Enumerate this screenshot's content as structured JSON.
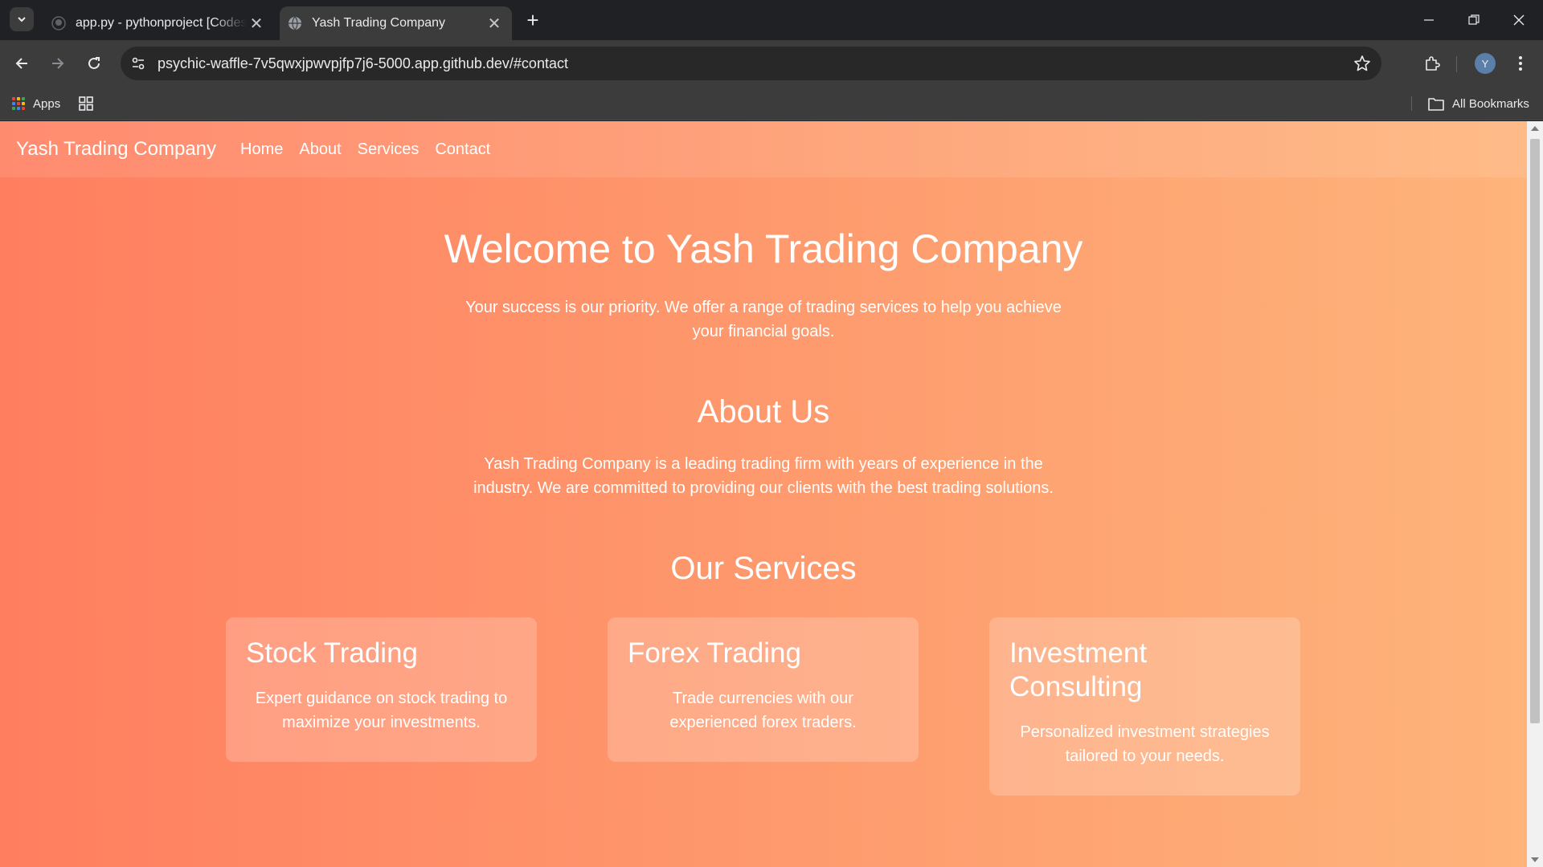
{
  "browser": {
    "tabs": [
      {
        "title": "app.py - pythonproject [Codespaces: psychic waffle]",
        "favicon": "github-icon",
        "active": false
      },
      {
        "title": "Yash Trading Company",
        "favicon": "globe-icon",
        "active": true
      }
    ],
    "url": "psychic-waffle-7v5qwxjpwvpjfp7j6-5000.app.github.dev/#contact",
    "avatar_letter": "Y",
    "bookmarks": {
      "apps_label": "Apps",
      "all_bookmarks_label": "All Bookmarks"
    }
  },
  "site": {
    "brand": "Yash Trading Company",
    "nav": [
      "Home",
      "About",
      "Services",
      "Contact"
    ],
    "hero": {
      "title": "Welcome to Yash Trading Company",
      "text": "Your success is our priority. We offer a range of trading services to help you achieve your financial goals."
    },
    "about": {
      "title": "About Us",
      "text": "Yash Trading Company is a leading trading firm with years of experience in the industry. We are committed to providing our clients with the best trading solutions."
    },
    "services": {
      "title": "Our Services",
      "items": [
        {
          "title": "Stock Trading",
          "text": "Expert guidance on stock trading to maximize your investments."
        },
        {
          "title": "Forex Trading",
          "text": "Trade currencies with our experienced forex traders."
        },
        {
          "title": "Investment Consulting",
          "text": "Personalized investment strategies tailored to your needs."
        }
      ]
    },
    "colors": {
      "gradient_start": "#ff7e5f",
      "gradient_end": "#feb47b"
    }
  }
}
